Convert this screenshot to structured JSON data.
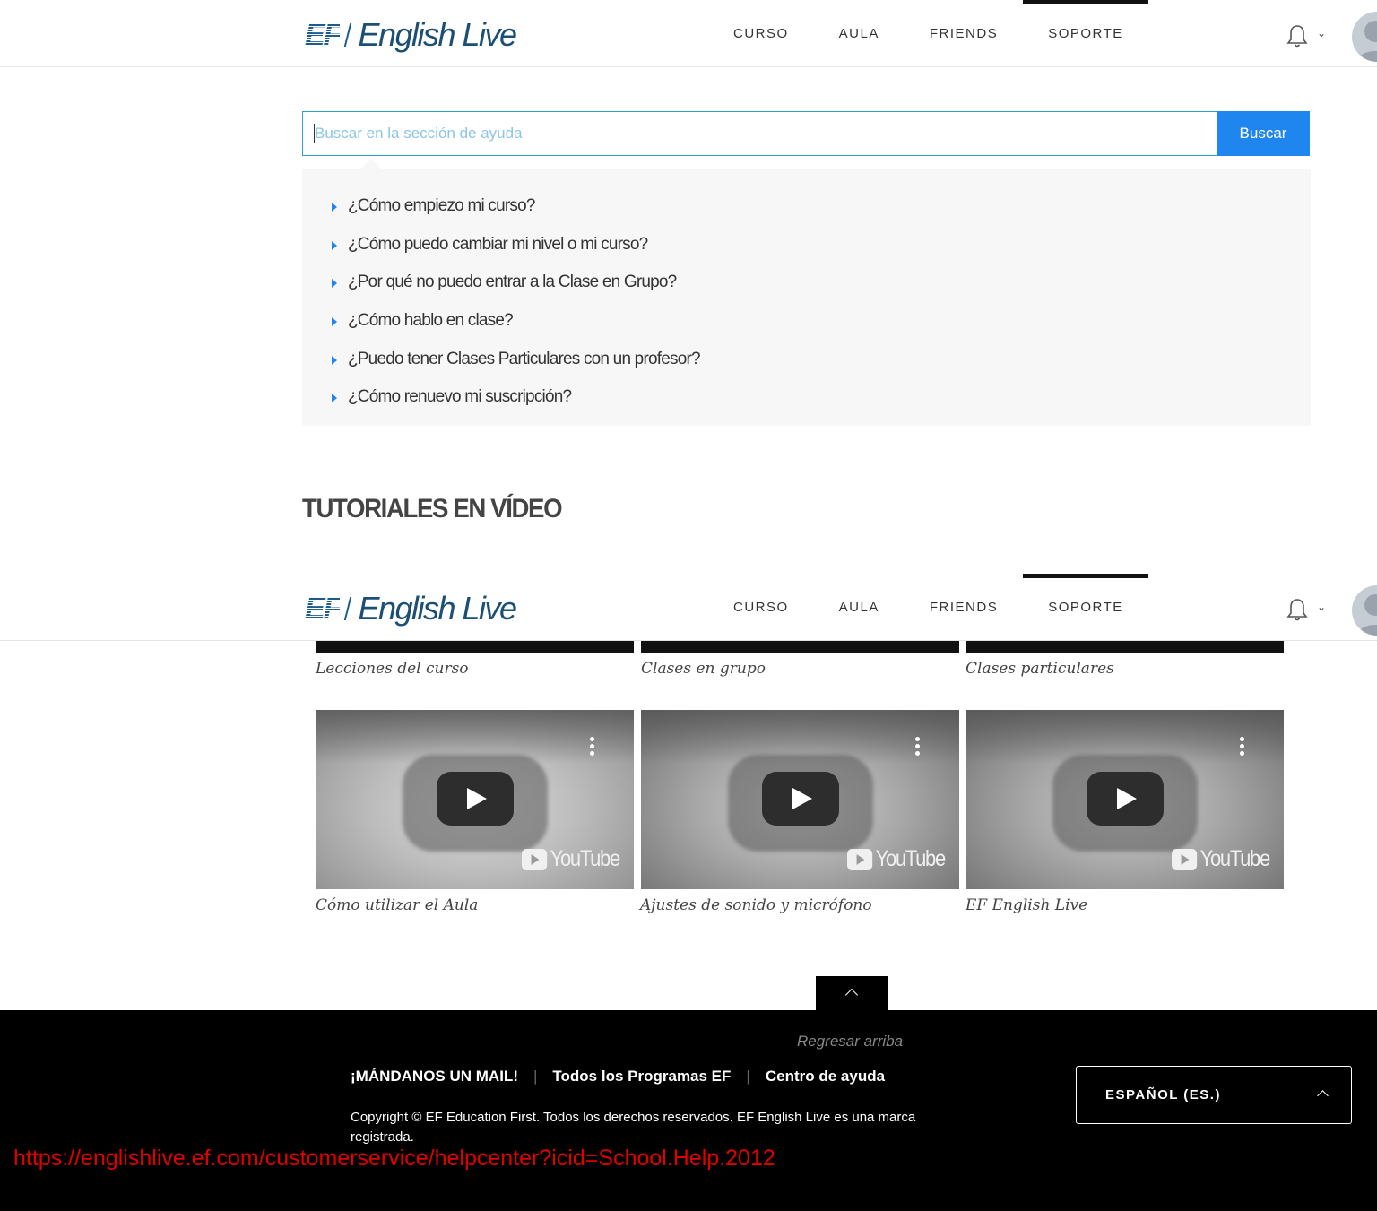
{
  "brand": {
    "mark": "EF",
    "name": "English Live",
    "color": "#1b4f74"
  },
  "nav": {
    "items": [
      {
        "label": "CURSO",
        "active": false
      },
      {
        "label": "AULA",
        "active": false
      },
      {
        "label": "FRIENDS",
        "active": false
      },
      {
        "label": "SOPORTE",
        "active": true
      }
    ]
  },
  "header_icons": {
    "notifications": "bell-icon",
    "menu": "chevron-down-icon",
    "profile": "avatar"
  },
  "search": {
    "placeholder": "Buscar en la sección de ayuda",
    "value": "",
    "button_label": "Buscar",
    "accent": "#1f86f0"
  },
  "faq": {
    "items": [
      "¿Cómo empiezo mi curso?",
      "¿Cómo puedo cambiar mi nivel o mi curso?",
      "¿Por qué no puedo entrar a la Clase en Grupo?",
      "¿Cómo hablo en clase?",
      "¿Puedo tener Clases Particulares con un profesor?",
      "¿Cómo renuevo mi suscripción?"
    ]
  },
  "tutorials": {
    "title": "TUTORIALES EN VÍDEO",
    "row1_captions": [
      "Lecciones del curso",
      "Clases en grupo",
      "Clases particulares"
    ],
    "row2": [
      {
        "caption": "Cómo utilizar el Aula",
        "provider": "YouTube"
      },
      {
        "caption": "Ajustes de sonido y micrófono",
        "provider": "YouTube"
      },
      {
        "caption": "EF English Live",
        "provider": "YouTube"
      }
    ]
  },
  "footer": {
    "back_to_top": "Regresar arriba",
    "links": [
      "¡MÁNDANOS UN MAIL!",
      "Todos los Programas EF",
      "Centro de ayuda"
    ],
    "separator": "|",
    "copyright": "Copyright © EF Education First. Todos los derechos reservados. EF English Live es una marca registrada.",
    "language": "ESPAÑOL (ES.)"
  },
  "status_url": "https://englishlive.ef.com/customerservice/helpcenter?icid=School.Help.2012"
}
